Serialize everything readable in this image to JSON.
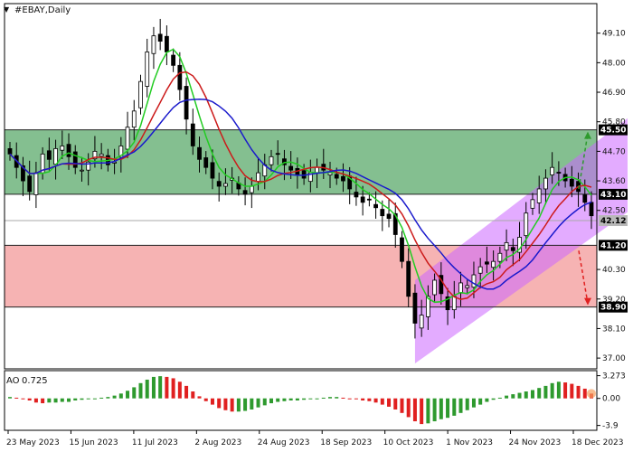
{
  "chart_data": {
    "type": "candlestick",
    "symbol_label": "#EBAY,Daily",
    "price_axis": {
      "ylim": [
        36.6,
        50.2
      ],
      "ticks": [
        {
          "value": 49.1,
          "label": "49.10"
        },
        {
          "value": 48.0,
          "label": "48.00"
        },
        {
          "value": 46.9,
          "label": "46.90"
        },
        {
          "value": 45.8,
          "label": "45.80"
        },
        {
          "value": 44.7,
          "label": "44.70"
        },
        {
          "value": 43.6,
          "label": "43.60"
        },
        {
          "value": 42.5,
          "label": "42.50"
        },
        {
          "value": 40.3,
          "label": "40.30"
        },
        {
          "value": 39.2,
          "label": "39.20"
        },
        {
          "value": 38.1,
          "label": "38.10"
        },
        {
          "value": 37.0,
          "label": "37.00"
        }
      ]
    },
    "level_tags": [
      {
        "value": 45.5,
        "label": "45.50",
        "bg": "#000000",
        "fg": "#ffffff"
      },
      {
        "value": 43.1,
        "label": "43.10",
        "bg": "#000000",
        "fg": "#ffffff"
      },
      {
        "value": 42.12,
        "label": "42.12",
        "bg": "#b8b8b8",
        "fg": "#000000"
      },
      {
        "value": 41.2,
        "label": "41.20",
        "bg": "#000000",
        "fg": "#ffffff"
      },
      {
        "value": 38.9,
        "label": "38.90",
        "bg": "#000000",
        "fg": "#ffffff"
      }
    ],
    "zones": [
      {
        "name": "resistance",
        "from": 43.1,
        "to": 45.5,
        "color": "#6fb47c"
      },
      {
        "name": "support",
        "from": 38.9,
        "to": 41.2,
        "color": "#f4a6a6"
      }
    ],
    "current_price": 42.12,
    "x_dates": [
      "23 May 2023",
      "15 Jun 2023",
      "11 Jul 2023",
      "2 Aug 2023",
      "24 Aug 2023",
      "18 Sep 2023",
      "10 Oct 2023",
      "1 Nov 2023",
      "24 Nov 2023",
      "18 Dec 2023"
    ],
    "closes": [
      44.6,
      44.1,
      43.6,
      43.2,
      43.9,
      44.6,
      44.4,
      44.8,
      44.9,
      44.5,
      44.1,
      44.0,
      44.3,
      44.7,
      44.6,
      44.2,
      44.3,
      44.9,
      45.6,
      46.2,
      47.3,
      48.4,
      49.0,
      48.8,
      48.4,
      47.9,
      47.0,
      45.9,
      44.9,
      44.4,
      44.1,
      43.7,
      43.4,
      43.5,
      43.7,
      43.3,
      43.1,
      43.4,
      43.9,
      44.2,
      44.5,
      44.6,
      44.2,
      44.0,
      43.8,
      43.7,
      43.9,
      44.1,
      44.0,
      43.9,
      43.7,
      43.6,
      43.3,
      43.0,
      42.8,
      42.9,
      42.6,
      42.3,
      42.2,
      41.6,
      40.6,
      39.3,
      38.3,
      38.6,
      39.3,
      39.9,
      39.4,
      38.8,
      39.3,
      39.8,
      39.7,
      40.1,
      40.4,
      40.5,
      40.6,
      40.9,
      41.3,
      41.0,
      41.5,
      42.4,
      42.9,
      43.3,
      43.7,
      44.1,
      43.9,
      43.6,
      43.4,
      43.2,
      42.8,
      42.3
    ],
    "ma_fast_color": "#22cc22",
    "ma_mid_color": "#cc1a1a",
    "ma_slow_color": "#1a1acc",
    "channel": {
      "color": "#cc66ff",
      "lower_start": {
        "date_index": 62,
        "price": 36.8
      },
      "lower_end": {
        "date_index": 89,
        "price": 42.3
      },
      "upper_start": {
        "date_index": 62,
        "price": 39.9
      },
      "upper_end": {
        "date_index": 89,
        "price": 45.8
      }
    },
    "forecast_arrows": [
      {
        "direction": "up",
        "color": "#2e9a2e",
        "to_price": 45.5
      },
      {
        "direction": "down",
        "color": "#e02020",
        "to_price": 38.9
      }
    ],
    "oscillator": {
      "name": "AO",
      "value_label": "0.725",
      "ylim": [
        -4.6,
        4.0
      ],
      "ticks": [
        {
          "value": 3.273,
          "label": "3.273"
        },
        {
          "value": 0.0,
          "label": "0.00"
        },
        {
          "value": -3.9,
          "label": "-3.9"
        }
      ],
      "up_color": "#2e9a2e",
      "down_color": "#e02020",
      "values": [
        0.2,
        0.1,
        0.0,
        -0.3,
        -0.6,
        -0.7,
        -0.6,
        -0.6,
        -0.5,
        -0.5,
        -0.3,
        -0.2,
        -0.1,
        0.0,
        0.1,
        0.2,
        0.4,
        0.7,
        1.1,
        1.6,
        2.2,
        2.7,
        3.1,
        3.2,
        3.1,
        2.9,
        2.4,
        1.8,
        1.0,
        0.3,
        -0.4,
        -0.9,
        -1.4,
        -1.7,
        -1.9,
        -1.9,
        -1.8,
        -1.6,
        -1.3,
        -1.0,
        -0.7,
        -0.5,
        -0.4,
        -0.3,
        -0.3,
        -0.2,
        -0.1,
        0.0,
        0.1,
        0.2,
        0.2,
        0.1,
        0.0,
        -0.1,
        -0.3,
        -0.4,
        -0.6,
        -0.9,
        -1.2,
        -1.6,
        -2.1,
        -2.7,
        -3.3,
        -3.7,
        -3.6,
        -3.3,
        -3.0,
        -2.8,
        -2.5,
        -2.1,
        -1.7,
        -1.3,
        -0.9,
        -0.5,
        -0.2,
        0.1,
        0.4,
        0.6,
        0.8,
        1.0,
        1.2,
        1.5,
        1.8,
        2.2,
        2.4,
        2.3,
        2.1,
        1.8,
        1.4,
        0.7
      ]
    }
  }
}
